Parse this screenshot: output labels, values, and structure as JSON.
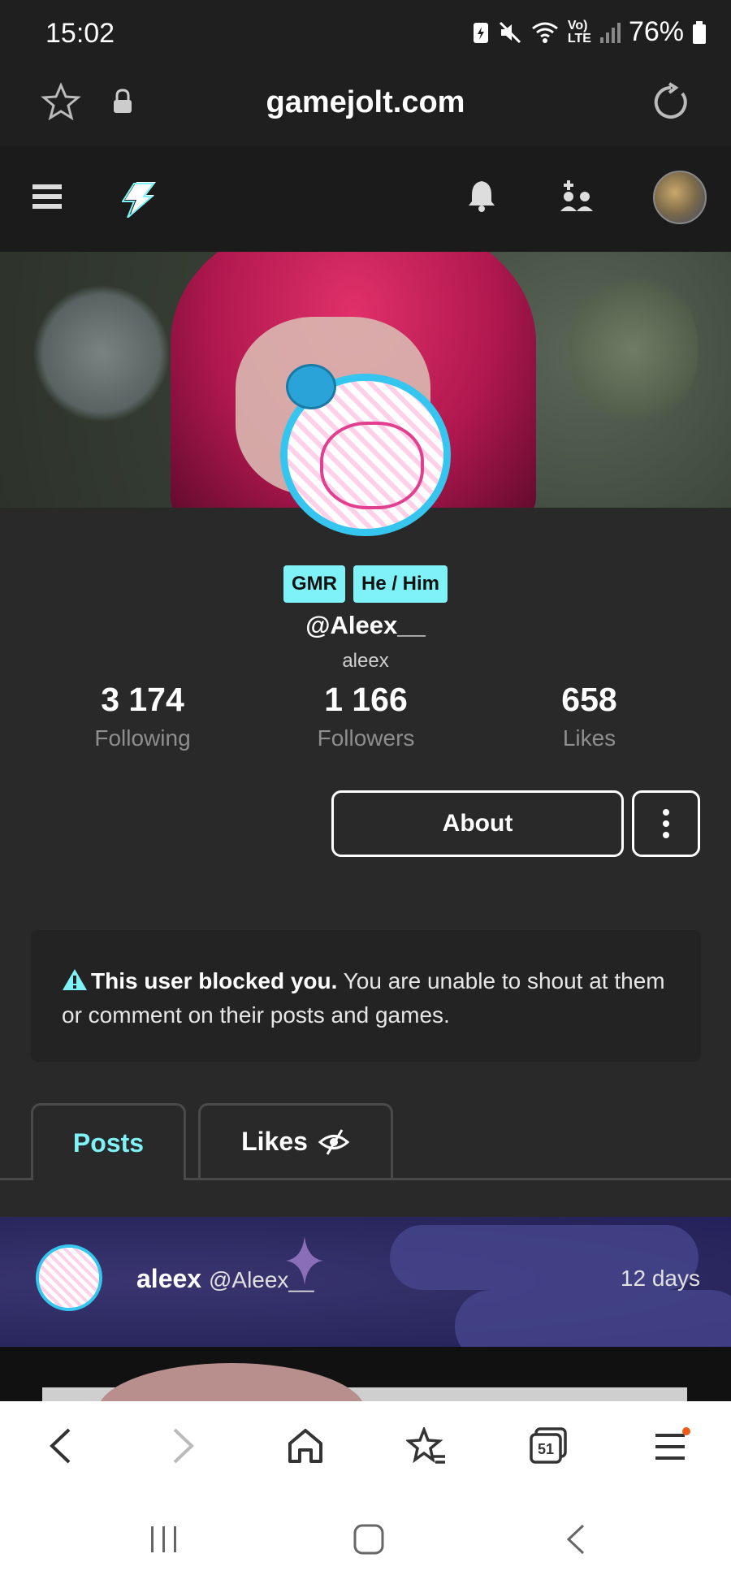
{
  "status_bar": {
    "time": "15:02",
    "battery": "76%"
  },
  "browser": {
    "url": "gamejolt.com",
    "tabs_count": "51"
  },
  "profile": {
    "tags": [
      "GMR",
      "He / Him"
    ],
    "handle": "@Aleex__",
    "display_name": "aleex",
    "stats": [
      {
        "value": "3 174",
        "label": "Following"
      },
      {
        "value": "1 166",
        "label": "Followers"
      },
      {
        "value": "658",
        "label": "Likes"
      }
    ],
    "about_label": "About"
  },
  "blocked_notice": {
    "bold": "This user blocked you.",
    "text": " You are unable to shout at them or comment on their posts and games."
  },
  "tabs": {
    "posts": "Posts",
    "likes": "Likes"
  },
  "post": {
    "author": "aleex",
    "handle": "@Aleex__",
    "time": "12 days"
  },
  "colors": {
    "accent": "#7ff2f7",
    "avatar_ring": "#35c5ef",
    "background": "#292929"
  }
}
